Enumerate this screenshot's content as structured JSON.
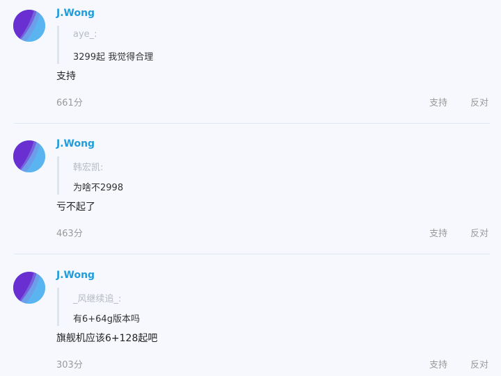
{
  "comments": [
    {
      "user": "J.Wong",
      "quote_author": "aye_:",
      "quote_text": "3299起 我觉得合理",
      "reply": "支持",
      "score": "661分",
      "upvote_label": "支持",
      "downvote_label": "反对"
    },
    {
      "user": "J.Wong",
      "quote_author": "韩宏凯:",
      "quote_text": "为啥不2998",
      "reply": "亏不起了",
      "score": "463分",
      "upvote_label": "支持",
      "downvote_label": "反对"
    },
    {
      "user": "J.Wong",
      "quote_author": "_风继续追_:",
      "quote_text": "有6+64g版本吗",
      "reply": "旗舰机应该6+128起吧",
      "score": "303分",
      "upvote_label": "支持",
      "downvote_label": "反对"
    }
  ],
  "colors": {
    "username": "#1f9ddc",
    "background": "#f6f8fd",
    "muted": "#999999",
    "avatar_purple": "#6a2fd1",
    "avatar_blue": "#5ab4ef"
  }
}
